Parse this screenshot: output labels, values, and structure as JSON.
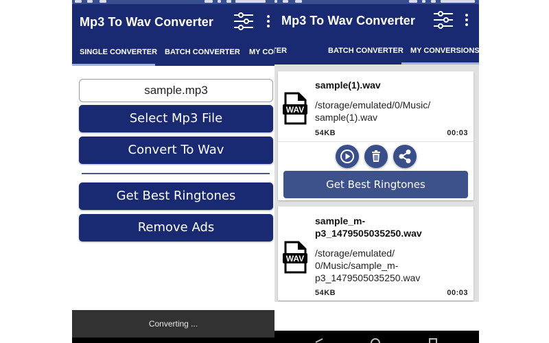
{
  "app": {
    "title": "Mp3 To Wav Converter",
    "brand_color": "#1a2a72",
    "accent_color": "#3d518a"
  },
  "left_screen": {
    "tabs": [
      {
        "label": "SINGLE CONVERTER",
        "active": true
      },
      {
        "label": "BATCH CONVERTER",
        "active": false
      },
      {
        "label": "MY CONVERSIONS",
        "active": false
      }
    ],
    "selected_file": "sample.mp3",
    "buttons": {
      "select_file": "Select Mp3 File",
      "convert": "Convert To Wav",
      "ringtones": "Get Best Ringtones",
      "remove_ads": "Remove Ads"
    },
    "snackbar": "Converting ..."
  },
  "right_screen": {
    "tabs": [
      {
        "label": "SINGLE CONVERTER",
        "active": false
      },
      {
        "label": "BATCH CONVERTER",
        "active": false
      },
      {
        "label": "MY CONVERSIONS",
        "active": true
      }
    ],
    "conversions": [
      {
        "name": "sample(1).wav",
        "path": "/storage/emulated/0/Music/sample(1).wav",
        "size": "54KB",
        "duration": "00:03",
        "expanded": true,
        "actions": [
          "play-icon",
          "delete-icon",
          "share-icon"
        ],
        "ringtones_label": "Get Best Ringtones"
      },
      {
        "name": "sample_mp3_1479505035250.wav",
        "path": "/storage/emulated/0/Music/sample_mp3_1479505035250.wav",
        "size": "54KB",
        "duration": "00:03",
        "expanded": false
      }
    ],
    "icon_label": "WAV"
  }
}
